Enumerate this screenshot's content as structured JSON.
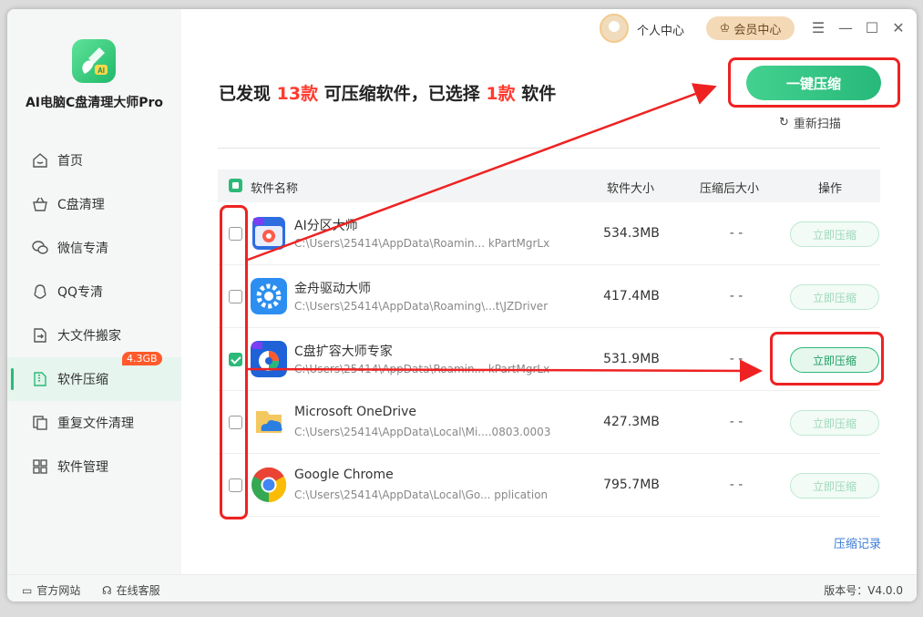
{
  "app": {
    "name": "AI电脑C盘清理大师Pro"
  },
  "header": {
    "personal_label": "个人中心",
    "vip_label": "会员中心"
  },
  "sidebar": {
    "items": [
      {
        "label": "首页",
        "icon": "home-icon"
      },
      {
        "label": "C盘清理",
        "icon": "basket-icon"
      },
      {
        "label": "微信专清",
        "icon": "wechat-icon"
      },
      {
        "label": "QQ专清",
        "icon": "qq-icon"
      },
      {
        "label": "大文件搬家",
        "icon": "move-file-icon"
      },
      {
        "label": "软件压缩",
        "icon": "zip-file-icon",
        "active": true,
        "badge": "4.3GB"
      },
      {
        "label": "重复文件清理",
        "icon": "duplicate-icon"
      },
      {
        "label": "软件管理",
        "icon": "grid-icon"
      }
    ]
  },
  "main": {
    "headline": {
      "p1": "已发现",
      "found": "13款",
      "p2": "可压缩软件，已选择",
      "selected": "1款",
      "p3": "软件"
    },
    "onekey_label": "一键压缩",
    "rescan_label": "重新扫描",
    "columns": {
      "name": "软件名称",
      "size": "软件大小",
      "compressed": "压缩后大小",
      "action": "操作"
    },
    "rows": [
      {
        "name": "AI分区大师",
        "path": "C:\\Users\\25414\\AppData\\Roamin... kPartMgrLx",
        "size": "534.3MB",
        "compressed": "- -",
        "action": "立即压缩",
        "checked": false
      },
      {
        "name": "金舟驱动大师",
        "path": "C:\\Users\\25414\\AppData\\Roaming\\...t\\JZDriver",
        "size": "417.4MB",
        "compressed": "- -",
        "action": "立即压缩",
        "checked": false
      },
      {
        "name": "C盘扩容大师专家",
        "path": "C:\\Users\\25414\\AppData\\Roamin... kPartMgrLx",
        "size": "531.9MB",
        "compressed": "- -",
        "action": "立即压缩",
        "checked": true
      },
      {
        "name": "Microsoft OneDrive",
        "path": "C:\\Users\\25414\\AppData\\Local\\Mi....0803.0003",
        "size": "427.3MB",
        "compressed": "- -",
        "action": "立即压缩",
        "checked": false
      },
      {
        "name": "Google Chrome",
        "path": "C:\\Users\\25414\\AppData\\Local\\Go... pplication",
        "size": "795.7MB",
        "compressed": "- -",
        "action": "立即压缩",
        "checked": false
      }
    ],
    "history_label": "压缩记录"
  },
  "footer": {
    "website_label": "官方网站",
    "service_label": "在线客服",
    "version": "版本号：V4.0.0"
  },
  "colors": {
    "accent": "#2cb979",
    "highlight_red": "#ff3b2f",
    "annotation_red": "#ee2222"
  }
}
